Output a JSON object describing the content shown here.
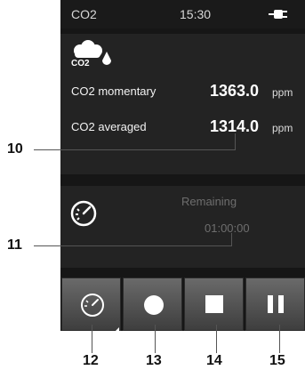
{
  "status_bar": {
    "title": "CO2",
    "time": "15:30",
    "power_icon": "plug-icon"
  },
  "measurements": {
    "icon": "co2-cloud-icon",
    "icon_text": "CO2",
    "rows": [
      {
        "label": "CO2 momentary",
        "value": "1363.0",
        "unit": "ppm"
      },
      {
        "label": "CO2 averaged",
        "value": "1314.0",
        "unit": "ppm"
      }
    ]
  },
  "timer": {
    "icon": "timer-icon",
    "label": "Remaining",
    "value": "01:00:00"
  },
  "buttons": [
    {
      "name": "timer-button",
      "icon": "timer-icon"
    },
    {
      "name": "record-button",
      "icon": "record-icon"
    },
    {
      "name": "stop-button",
      "icon": "stop-icon"
    },
    {
      "name": "pause-button",
      "icon": "pause-icon"
    }
  ],
  "callouts": [
    "10",
    "11",
    "12",
    "13",
    "14",
    "15"
  ],
  "colors": {
    "screen_bg": "#161616",
    "panel_bg": "#232323",
    "button_top": "#6a6a6a",
    "button_bottom": "#3e3e3e"
  }
}
